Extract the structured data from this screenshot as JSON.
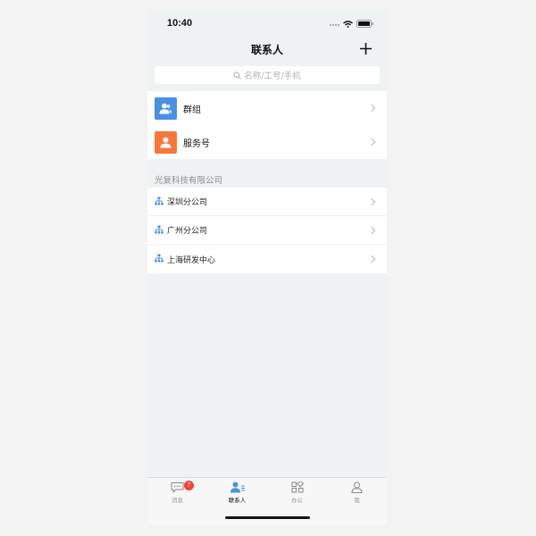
{
  "status_bar": {
    "time": "10:40"
  },
  "nav": {
    "title": "联系人",
    "add_label": "+"
  },
  "search": {
    "placeholder": "名称/工号/手机"
  },
  "quick_items": [
    {
      "label": "群组",
      "icon": "group-icon",
      "color": "#4a90e2"
    },
    {
      "label": "服务号",
      "icon": "user-icon",
      "color": "#f5773b"
    }
  ],
  "company": {
    "name": "光复科技有限公司",
    "departments": [
      {
        "label": "深圳分公司"
      },
      {
        "label": "广州分公司"
      },
      {
        "label": "上海研发中心"
      }
    ]
  },
  "tabbar": {
    "tabs": [
      {
        "label": "消息",
        "icon": "chat-icon",
        "badge": "7"
      },
      {
        "label": "联系人",
        "icon": "contacts-icon",
        "active": true
      },
      {
        "label": "办公",
        "icon": "apps-icon"
      },
      {
        "label": "我",
        "icon": "profile-icon"
      }
    ]
  },
  "colors": {
    "accent": "#4a90e2",
    "badge": "#f2423a",
    "service": "#f5773b"
  }
}
